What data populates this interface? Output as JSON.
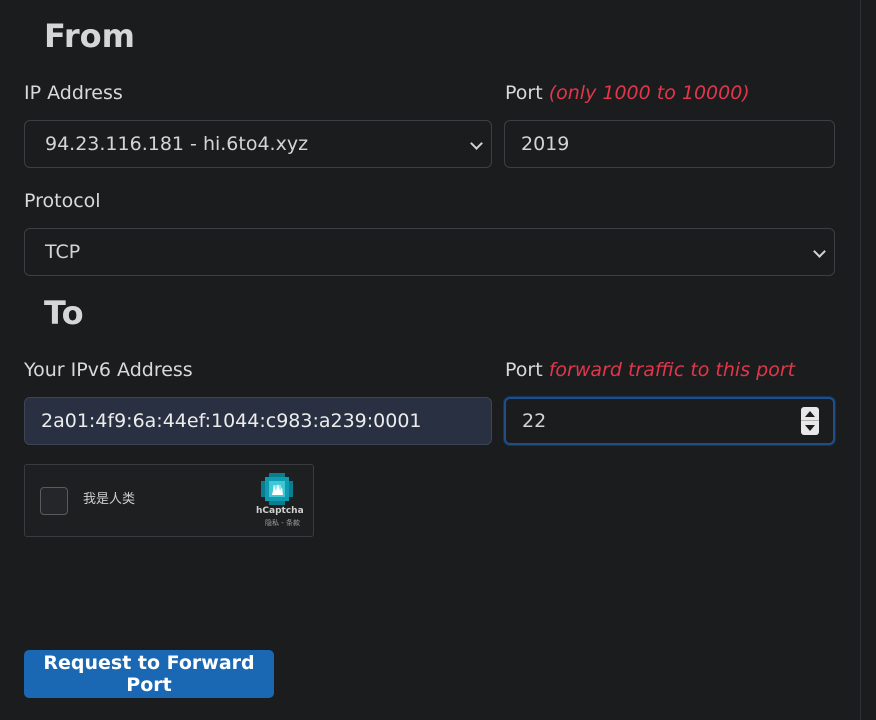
{
  "from": {
    "title": "From",
    "ip_label": "IP Address",
    "ip_value": "94.23.116.181 - hi.6to4.xyz",
    "port_label": "Port",
    "port_hint": "(only 1000 to 10000)",
    "port_value": "2019",
    "protocol_label": "Protocol",
    "protocol_value": "TCP"
  },
  "to": {
    "title": "To",
    "ipv6_label": "Your IPv6 Address",
    "ipv6_value": "2a01:4f9:6a:44ef:1044:c983:a239:0001",
    "port_label": "Port",
    "port_hint": "forward traffic to this port",
    "port_value": "22"
  },
  "captcha": {
    "label": "我是人类",
    "brand": "hCaptcha",
    "links": "隐私 - 条款"
  },
  "submit_label": "Request to Forward Port",
  "colors": {
    "background": "#1b1c1e",
    "hint": "#e2364b",
    "button": "#1a67b3",
    "ipv6_field": "#283041"
  }
}
